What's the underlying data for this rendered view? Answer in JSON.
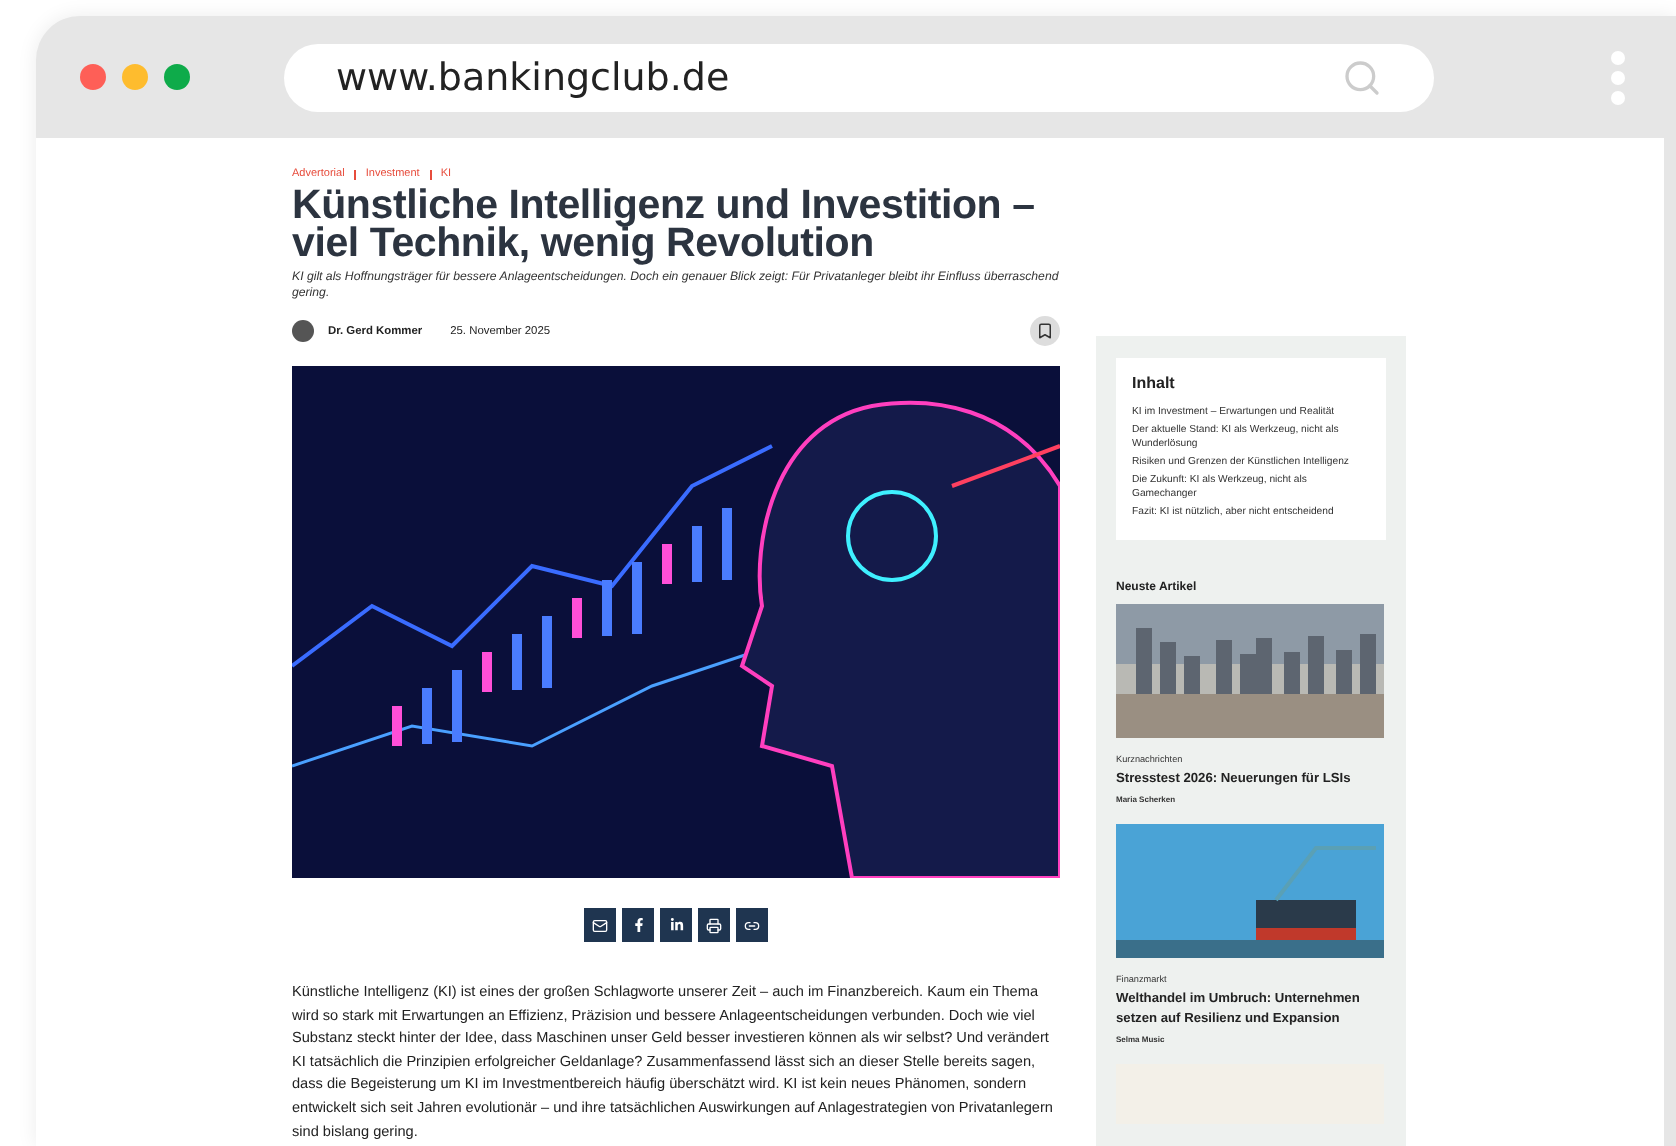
{
  "browser": {
    "url": "www.bankingclub.de"
  },
  "article": {
    "breadcrumbs": [
      "Advertorial",
      "Investment",
      "KI"
    ],
    "title": "Künstliche Intelligenz und Investition – viel Technik, wenig Revolution",
    "lead": "KI gilt als Hoffnungsträger für bessere Anlageentscheidungen. Doch ein genauer Blick zeigt: Für Privatanleger bleibt ihr Einfluss überraschend gering.",
    "author": "Dr. Gerd Kommer",
    "date": "25. November 2025",
    "share": [
      {
        "kind": "mail"
      },
      {
        "kind": "facebook"
      },
      {
        "kind": "linkedin"
      },
      {
        "kind": "print"
      },
      {
        "kind": "link"
      }
    ],
    "body": "Künstliche Intelligenz (KI) ist eines der großen Schlagworte unserer Zeit – auch im Finanzbereich. Kaum ein Thema wird so stark mit Erwartungen an Effizienz, Präzision und bessere Anlageentscheidungen verbunden. Doch wie viel Substanz steckt hinter der Idee, dass Maschinen unser Geld besser investieren können als wir selbst? Und verändert KI tatsächlich die Prinzipien erfolgreicher Geldanlage? Zusammenfassend lässt sich an dieser Stelle bereits sagen, dass die Begeisterung um KI im Investmentbereich häufig überschätzt wird. KI ist kein neues Phänomen, sondern entwickelt sich seit Jahren evolutionär – und ihre tatsächlichen Auswirkungen auf Anlagestrategien von Privatanlegern sind bislang gering."
  },
  "sidebar": {
    "toc": {
      "title": "Inhalt",
      "items": [
        "KI im Investment – Erwartungen und Realität",
        "Der aktuelle Stand: KI als Werkzeug, nicht als Wunderlösung",
        "Risiken und Grenzen der Künstlichen Intelligenz",
        "Die Zukunft: KI als Werkzeug, nicht als Gamechanger",
        "Fazit: KI ist nützlich, aber nicht entscheidend"
      ]
    },
    "latest_title": "Neuste Artikel",
    "latest": [
      {
        "kind": "city",
        "category": "Kurznachrichten",
        "title": "Stresstest 2026: Neuerungen für LSIs",
        "author": "Maria Scherken"
      },
      {
        "kind": "port",
        "category": "Finanzmarkt",
        "title": "Welthandel im Umbruch: Unternehmen setzen auf Resilienz und Expansion",
        "author": "Selma Music"
      }
    ]
  }
}
